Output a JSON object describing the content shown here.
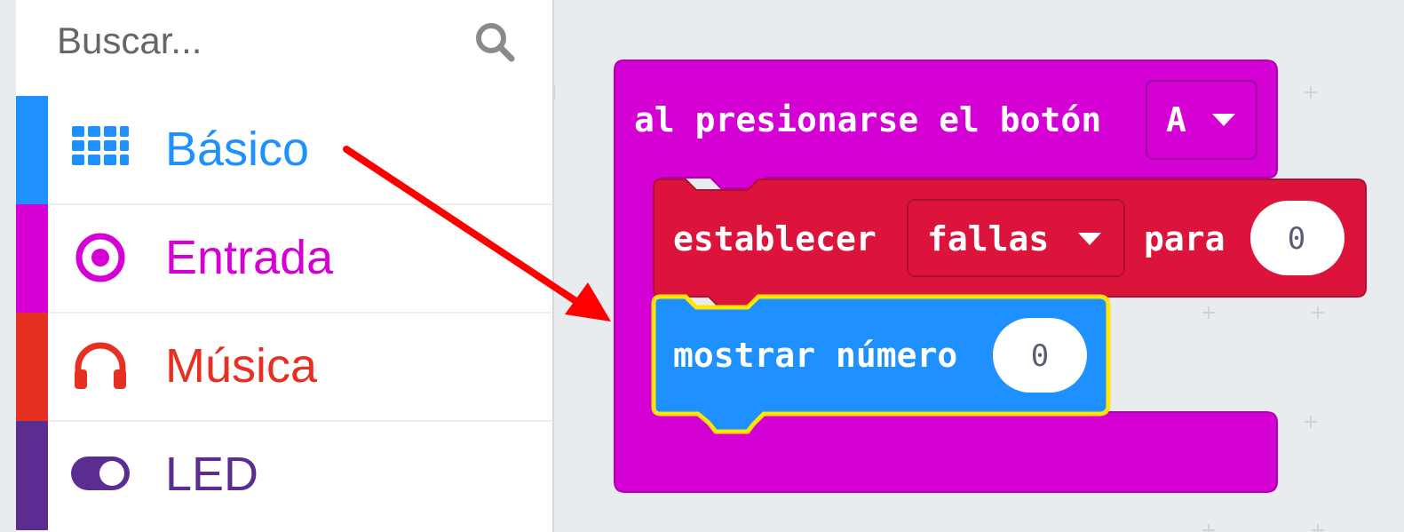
{
  "search": {
    "placeholder": "Buscar..."
  },
  "categories": [
    {
      "label": "Básico",
      "color": "#1e90ff",
      "icon": "grid-icon"
    },
    {
      "label": "Entrada",
      "color": "#d400d4",
      "icon": "target-icon"
    },
    {
      "label": "Música",
      "color": "#e63022",
      "icon": "headphones-icon"
    },
    {
      "label": "LED",
      "color": "#5c2d91",
      "icon": "toggle-icon"
    }
  ],
  "blocks": {
    "event": {
      "text": "al presionarse el botón",
      "button_value": "A",
      "color": "#d400d4"
    },
    "set_var": {
      "prefix": "establecer",
      "variable": "fallas",
      "mid": "para",
      "value": "0",
      "color": "#dc143c"
    },
    "show_number": {
      "text": "mostrar número",
      "value": "0",
      "color": "#1e90ff",
      "highlight": "#ffe500"
    }
  },
  "annotation": {
    "arrow_color": "#ff0000"
  }
}
